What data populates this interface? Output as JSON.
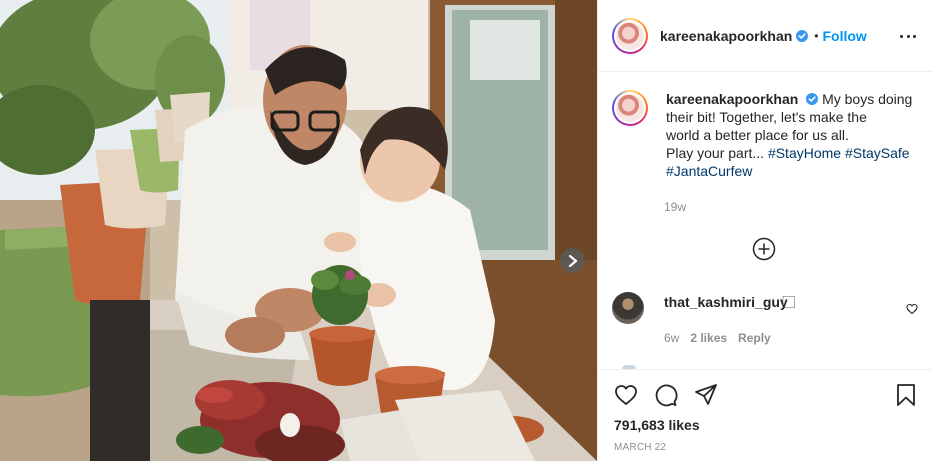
{
  "post": {
    "author": "kareenakapoorkhan",
    "follow_label": "Follow",
    "separator": "•",
    "caption": {
      "username": "kareenakapoorkhan",
      "line1": "My boys doing",
      "line2": "their bit! Together, let's make the",
      "line3": "world a better place for us all.",
      "line4_text": "Play your part...",
      "hashtags_line4": [
        "#StayHome",
        "#StaySafe"
      ],
      "hashtags_line5": [
        "#JantaCurfew"
      ],
      "time": "19w"
    },
    "comments": [
      {
        "username": "that_kashmiri_guy",
        "trailing": "⃞",
        "time": "6w",
        "likes": "2 likes",
        "reply_label": "Reply"
      }
    ],
    "likes_count": "791,683 likes",
    "date": "MARCH 22"
  },
  "icons": {
    "verified": "verified-badge-icon",
    "more": "more-options-icon",
    "load_more": "add-circle-icon",
    "comment_like": "heart-icon",
    "like": "heart-icon",
    "comment": "comment-icon",
    "share": "paper-plane-icon",
    "save": "bookmark-icon",
    "next": "chevron-right-icon"
  },
  "colors": {
    "link_blue": "#0095f6",
    "hashtag": "#00376b",
    "muted": "#8e8e8e",
    "text": "#262626"
  }
}
